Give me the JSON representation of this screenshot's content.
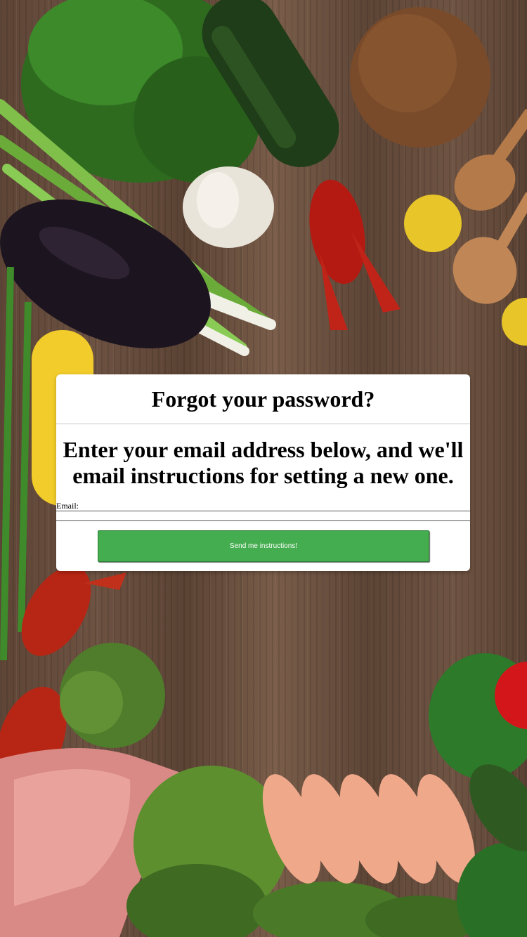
{
  "page": {
    "title": "Forgot your password?",
    "instructions": "Enter your email address below, and we'll email instructions for setting a new one."
  },
  "form": {
    "email_label": "Email:",
    "email_value": "",
    "submit_label": "Send me instructions!"
  },
  "colors": {
    "button": "#44ad4f",
    "card": "#ffffff",
    "wood": "#6d5242"
  },
  "background": {
    "icon": "food-ingredients-photo"
  }
}
